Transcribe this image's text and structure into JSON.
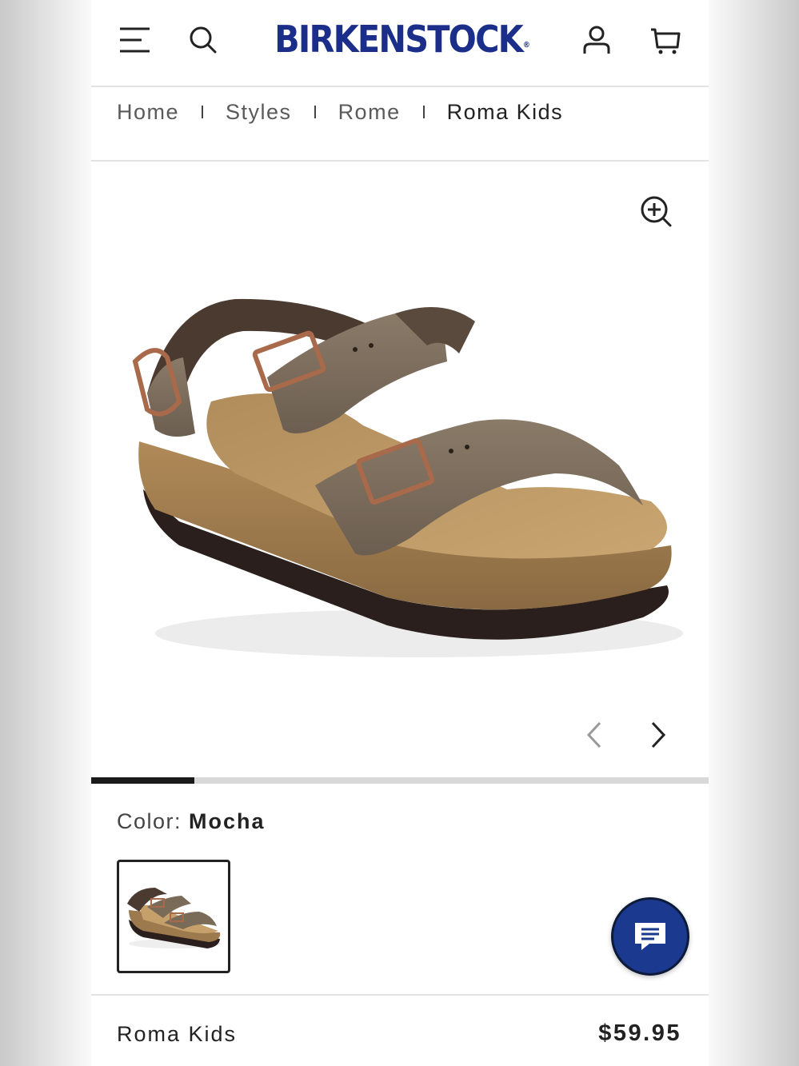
{
  "header": {
    "brand": "BIRKENSTOCK",
    "brand_mark": "®",
    "icons": [
      "menu-icon",
      "search-icon",
      "account-icon",
      "cart-icon"
    ]
  },
  "breadcrumb": {
    "items": [
      "Home",
      "Styles",
      "Rome"
    ],
    "current": "Roma Kids"
  },
  "gallery": {
    "image_alt": "Roma Kids sandal in Mocha",
    "progress": 0.167,
    "icons": [
      "zoom-in-icon",
      "chevron-left-icon",
      "chevron-right-icon"
    ]
  },
  "color": {
    "label": "Color:",
    "value": "Mocha"
  },
  "product": {
    "name": "Roma Kids",
    "price": "$59.95"
  },
  "chat": {
    "icon": "chat-icon"
  },
  "colors": {
    "brand": "#1b2e8a",
    "chat_bg": "#1b3a8f",
    "progress_fill": "#1a1a1a",
    "progress_track": "#d8d8d8"
  }
}
